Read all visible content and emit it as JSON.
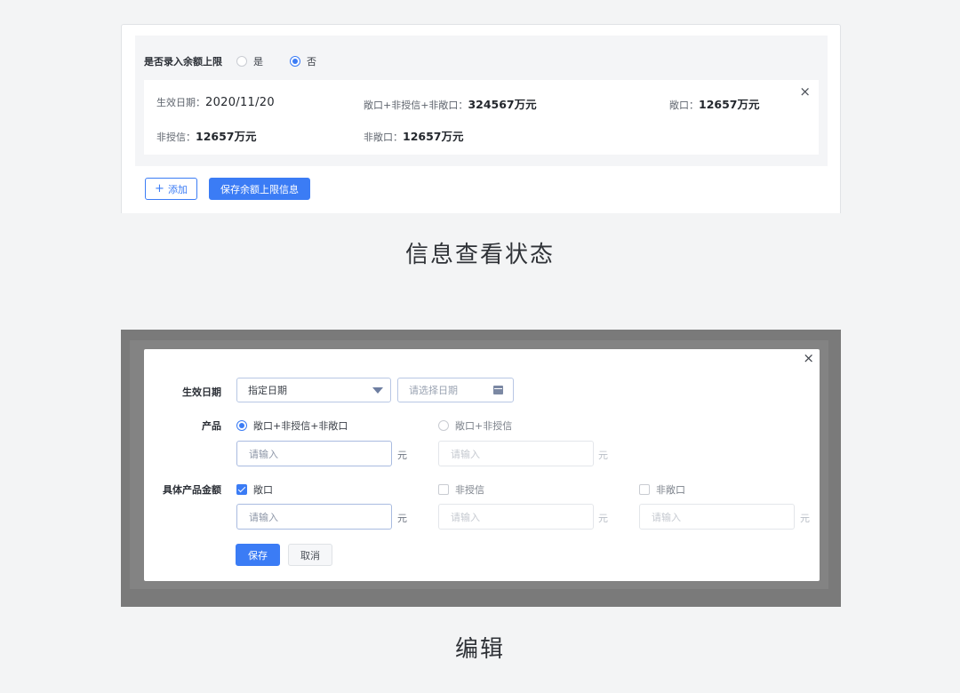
{
  "view": {
    "limit_label": "是否录入余额上限",
    "limit_options": [
      "是",
      "否"
    ],
    "limit_selected": "否",
    "card": {
      "effective_date_label": "生效日期：",
      "effective_date_value": "2020/11/20",
      "total_label": "敞口+非授信+非敞口：",
      "total_value": "324567万元",
      "exposure_label": "敞口：",
      "exposure_value": "12657万元",
      "non_credit_label": "非授信：",
      "non_credit_value": "12657万元",
      "non_exposure_label": "非敞口：",
      "non_exposure_value": "12657万元",
      "close_icon": "×"
    },
    "add_button": "添加",
    "add_icon": "+",
    "save_button": "保存余额上限信息",
    "caption": "信息查看状态"
  },
  "edit": {
    "close_icon": "×",
    "effective_date_label": "生效日期",
    "date_mode_selected": "指定日期",
    "date_placeholder": "请选择日期",
    "product_label": "产品",
    "product_options": [
      "敞口+非授信+非敞口",
      "敞口+非授信"
    ],
    "product_selected": "敞口+非授信+非敞口",
    "amount_placeholder": "请输入",
    "unit": "元",
    "specific_amount_label": "具体产品金额",
    "specific_options": [
      {
        "label": "敞口",
        "checked": true
      },
      {
        "label": "非授信",
        "checked": false
      },
      {
        "label": "非敞口",
        "checked": false
      }
    ],
    "save_button": "保存",
    "cancel_button": "取消",
    "caption": "编辑"
  },
  "colors": {
    "primary": "#3b7cf5",
    "background": "#f3f4f5",
    "overlay": "#7a7a7a"
  },
  "icons": [
    "close-icon",
    "plus-icon",
    "chevron-down-icon",
    "calendar-icon",
    "radio-icon",
    "checkbox-icon"
  ]
}
